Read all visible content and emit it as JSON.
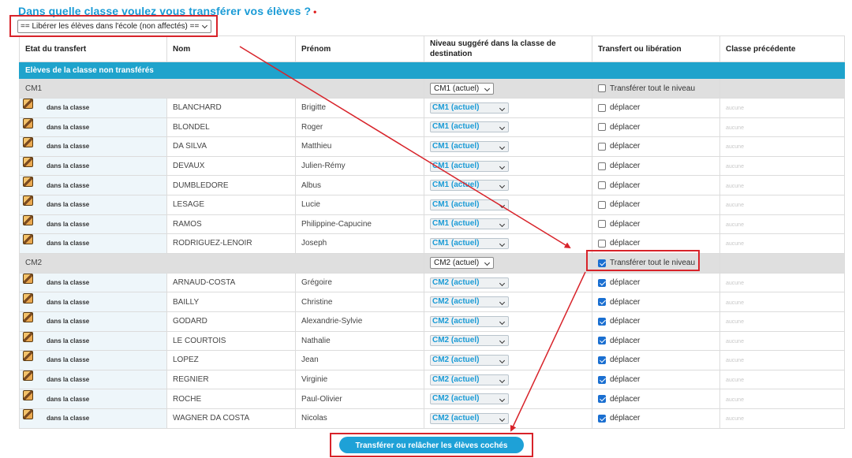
{
  "question": {
    "label": "Dans quelle classe voulez vous transférer vos élèves ?",
    "required_mark": "•"
  },
  "destination_select": {
    "value": "== Libérer les élèves dans l'école (non affectés) =="
  },
  "columns": {
    "state": "Etat du transfert",
    "lastname": "Nom",
    "firstname": "Prénom",
    "level": "Niveau suggéré dans la classe de destination",
    "transfer": "Transfert ou libération",
    "previous": "Classe précédente"
  },
  "section_title": "Elèves de la classe non transférés",
  "groups": [
    {
      "name": "CM1",
      "level_value": "CM1 (actuel)",
      "transfer_all_label": "Transférer tout le niveau",
      "transfer_all_checked": false,
      "pupils": [
        {
          "state": "dans la classe",
          "lastname": "BLANCHARD",
          "firstname": "Brigitte",
          "level": "CM1 (actuel)",
          "action": "déplacer",
          "checked": false,
          "previous": "aucune"
        },
        {
          "state": "dans la classe",
          "lastname": "BLONDEL",
          "firstname": "Roger",
          "level": "CM1 (actuel)",
          "action": "déplacer",
          "checked": false,
          "previous": "aucune"
        },
        {
          "state": "dans la classe",
          "lastname": "DA SILVA",
          "firstname": "Matthieu",
          "level": "CM1 (actuel)",
          "action": "déplacer",
          "checked": false,
          "previous": "aucune"
        },
        {
          "state": "dans la classe",
          "lastname": "DEVAUX",
          "firstname": "Julien-Rémy",
          "level": "CM1 (actuel)",
          "action": "déplacer",
          "checked": false,
          "previous": "aucune"
        },
        {
          "state": "dans la classe",
          "lastname": "DUMBLEDORE",
          "firstname": "Albus",
          "level": "CM1 (actuel)",
          "action": "déplacer",
          "checked": false,
          "previous": "aucune"
        },
        {
          "state": "dans la classe",
          "lastname": "LESAGE",
          "firstname": "Lucie",
          "level": "CM1 (actuel)",
          "action": "déplacer",
          "checked": false,
          "previous": "aucune"
        },
        {
          "state": "dans la classe",
          "lastname": "RAMOS",
          "firstname": "Philippine-Capucine",
          "level": "CM1 (actuel)",
          "action": "déplacer",
          "checked": false,
          "previous": "aucune"
        },
        {
          "state": "dans la classe",
          "lastname": "RODRIGUEZ-LENOIR",
          "firstname": "Joseph",
          "level": "CM1 (actuel)",
          "action": "déplacer",
          "checked": false,
          "previous": "aucune"
        }
      ]
    },
    {
      "name": "CM2",
      "level_value": "CM2 (actuel)",
      "transfer_all_label": "Transférer tout le niveau",
      "transfer_all_checked": true,
      "pupils": [
        {
          "state": "dans la classe",
          "lastname": "ARNAUD-COSTA",
          "firstname": "Grégoire",
          "level": "CM2 (actuel)",
          "action": "déplacer",
          "checked": true,
          "previous": "aucune"
        },
        {
          "state": "dans la classe",
          "lastname": "BAILLY",
          "firstname": "Christine",
          "level": "CM2 (actuel)",
          "action": "déplacer",
          "checked": true,
          "previous": "aucune"
        },
        {
          "state": "dans la classe",
          "lastname": "GODARD",
          "firstname": "Alexandrie-Sylvie",
          "level": "CM2 (actuel)",
          "action": "déplacer",
          "checked": true,
          "previous": "aucune"
        },
        {
          "state": "dans la classe",
          "lastname": "LE COURTOIS",
          "firstname": "Nathalie",
          "level": "CM2 (actuel)",
          "action": "déplacer",
          "checked": true,
          "previous": "aucune"
        },
        {
          "state": "dans la classe",
          "lastname": "LOPEZ",
          "firstname": "Jean",
          "level": "CM2 (actuel)",
          "action": "déplacer",
          "checked": true,
          "previous": "aucune"
        },
        {
          "state": "dans la classe",
          "lastname": "REGNIER",
          "firstname": "Virginie",
          "level": "CM2 (actuel)",
          "action": "déplacer",
          "checked": true,
          "previous": "aucune"
        },
        {
          "state": "dans la classe",
          "lastname": "ROCHE",
          "firstname": "Paul-Olivier",
          "level": "CM2 (actuel)",
          "action": "déplacer",
          "checked": true,
          "previous": "aucune"
        },
        {
          "state": "dans la classe",
          "lastname": "WAGNER DA COSTA",
          "firstname": "Nicolas",
          "level": "CM2 (actuel)",
          "action": "déplacer",
          "checked": true,
          "previous": "aucune"
        }
      ]
    }
  ],
  "submit_label": "Transférer ou relâcher les élèves cochés",
  "colors": {
    "accent": "#1a9bd6",
    "section_bar": "#1fa3cc",
    "annotation": "#d8232a",
    "checkbox_on": "#1a6fd1"
  }
}
